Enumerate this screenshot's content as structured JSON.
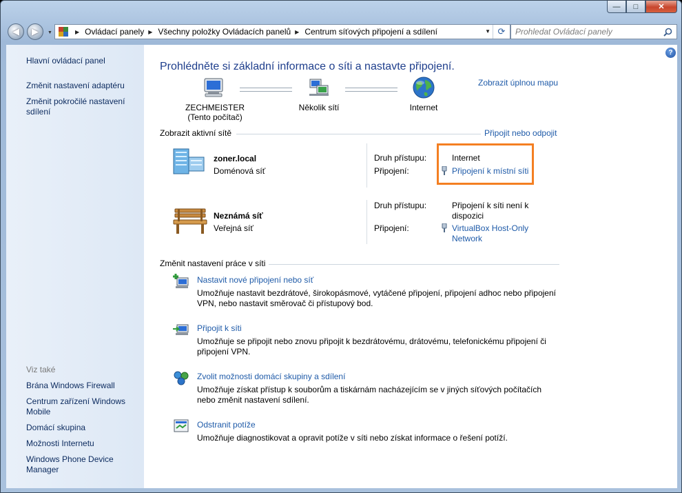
{
  "window": {
    "caption_buttons": {
      "minimize": "—",
      "maximize": "□",
      "close": "✕"
    }
  },
  "navigation": {
    "back_icon": "back-arrow-icon",
    "forward_icon": "forward-arrow-icon",
    "breadcrumbs": [
      "Ovládací panely",
      "Všechny položky Ovládacích panelů",
      "Centrum síťových připojení a sdílení"
    ],
    "search_placeholder": "Prohledat Ovládací panely"
  },
  "sidebar": {
    "items": [
      {
        "label": "Hlavní ovládací panel"
      },
      {
        "label": "Změnit nastavení adaptéru"
      },
      {
        "label": "Změnit pokročilé nastavení sdílení"
      }
    ],
    "see_also_label": "Viz také",
    "see_also": [
      {
        "label": "Brána Windows Firewall"
      },
      {
        "label": "Centrum zařízení Windows Mobile"
      },
      {
        "label": "Domácí skupina"
      },
      {
        "label": "Možnosti Internetu"
      },
      {
        "label": "Windows Phone Device Manager"
      }
    ]
  },
  "main": {
    "title": "Prohlédněte si základní informace o síti a nastavte připojení.",
    "full_map_link": "Zobrazit úplnou mapu",
    "map": {
      "computer_name": "ZECHMEISTER",
      "computer_sub": "(Tento počítač)",
      "middle": "Několik sítí",
      "internet": "Internet"
    },
    "active_networks": {
      "heading": "Zobrazit aktivní sítě",
      "connect_link": "Připojit nebo odpojit",
      "access_label": "Druh přístupu:",
      "connection_label": "Připojení:",
      "networks": [
        {
          "name": "zoner.local",
          "type": "Doménová síť",
          "access": "Internet",
          "connection": "Připojení k místní síti"
        },
        {
          "name": "Neznámá síť",
          "type": "Veřejná síť",
          "access": "Připojení k síti není k dispozici",
          "connection": "VirtualBox Host-Only Network"
        }
      ]
    },
    "change_settings": {
      "heading": "Změnit nastavení práce v síti",
      "tasks": [
        {
          "title": "Nastavit nové připojení nebo síť",
          "desc": "Umožňuje nastavit bezdrátové, širokopásmové, vytáčené připojení, připojení adhoc nebo připojení VPN, nebo nastavit směrovač či přístupový bod."
        },
        {
          "title": "Připojit k síti",
          "desc": "Umožňuje se připojit nebo znovu připojit k bezdrátovému, drátovému, telefonickému připojení či připojení VPN."
        },
        {
          "title": "Zvolit možnosti domácí skupiny a sdílení",
          "desc": "Umožňuje získat přístup k souborům a tiskárnám nacházejícím se v jiných síťových počítačích nebo změnit nastavení sdílení."
        },
        {
          "title": "Odstranit potíže",
          "desc": "Umožňuje diagnostikovat a opravit potíže v síti nebo získat informace o řešení potíží."
        }
      ]
    }
  }
}
